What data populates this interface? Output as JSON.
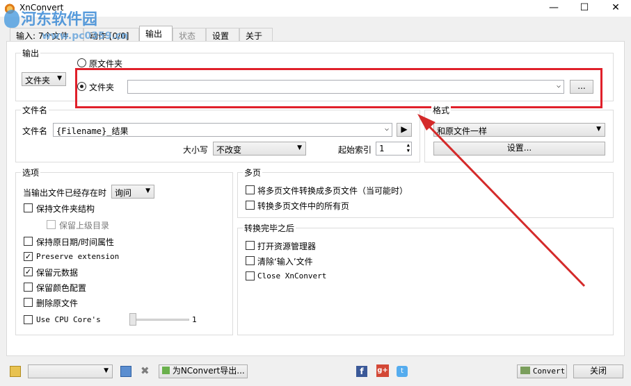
{
  "window": {
    "title": "XnConvert",
    "minimize": "—",
    "maximize": "☐",
    "close": "✕"
  },
  "watermark": {
    "site": "河东软件园",
    "url": "www.pc0359.cn"
  },
  "tabs": [
    {
      "label": "输入: 7个文件"
    },
    {
      "label": "动作 [0/0]"
    },
    {
      "label": "输出"
    },
    {
      "label": "状态"
    },
    {
      "label": "设置"
    },
    {
      "label": "关于"
    }
  ],
  "output": {
    "group_label": "输出",
    "type_select": "文件夹",
    "radio_source": "原文件夹",
    "radio_folder": "文件夹",
    "folder_path": "",
    "browse_label": "..."
  },
  "filename": {
    "group_label": "文件名",
    "label": "文件名",
    "value": "{Filename}_结果",
    "case_label": "大小写",
    "case_value": "不改变",
    "index_label": "起始索引",
    "index_value": "1"
  },
  "format": {
    "group_label": "格式",
    "value": "和原文件一样",
    "settings_label": "设置..."
  },
  "options": {
    "group_label": "选项",
    "exists_label": "当输出文件已经存在时",
    "exists_value": "询问",
    "keep_structure": "保持文件夹结构",
    "keep_parent": "保留上级目录",
    "keep_date": "保持原日期/时间属性",
    "preserve_ext": "Preserve extension",
    "keep_meta": "保留元数据",
    "keep_color": "保留颜色配置",
    "delete_orig": "删除原文件",
    "cpu_label": "Use CPU Core's",
    "cpu_value": "1",
    "cpu_fraction": 0.0
  },
  "multipage": {
    "group_label": "多页",
    "to_multipage": "将多页文件转换成多页文件（当可能时）",
    "convert_all": "转换多页文件中的所有页"
  },
  "after": {
    "group_label": "转换完毕之后",
    "open_explorer": "打开资源管理器",
    "clear_input": "清除‘输入’文件",
    "close_app": "Close XnConvert"
  },
  "bottom": {
    "preset_value": "",
    "export_label": "为NConvert导出...",
    "convert_label": "Convert",
    "close_label": "关闭"
  },
  "colors": {
    "highlight": "#e0202a",
    "arrow": "#d42a2a"
  }
}
